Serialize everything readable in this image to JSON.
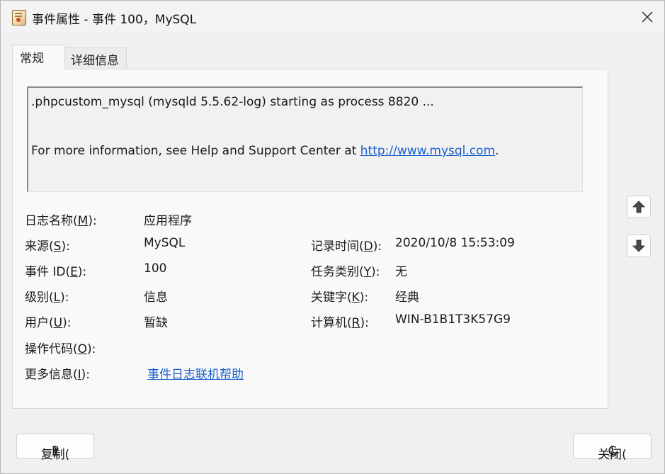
{
  "window": {
    "title": "事件属性 - 事件 100，MySQL",
    "close_icon": "close-icon"
  },
  "tabs": [
    {
      "label": "常规",
      "active": true
    },
    {
      "label": "详细信息",
      "active": false
    }
  ],
  "message": {
    "line1": ".phpcustom_mysql (mysqld 5.5.62-log) starting as process 8820 ...",
    "line2_prefix": "For more information, see Help and Support Center at ",
    "link": "http://www.mysql.com",
    "line2_suffix": "."
  },
  "fields": {
    "log_name": {
      "label_pre": "日志名称(",
      "key": "M",
      "label_post": "):",
      "value": "应用程序"
    },
    "source": {
      "label_pre": "来源(",
      "key": "S",
      "label_post": "):",
      "value": "MySQL"
    },
    "logged": {
      "label_pre": "记录时间(",
      "key": "D",
      "label_post": "):",
      "value": "2020/10/8 15:53:09"
    },
    "event_id": {
      "label_pre": "事件 ID(",
      "key": "E",
      "label_post": "):",
      "value": "100"
    },
    "task_category": {
      "label_pre": "任务类别(",
      "key": "Y",
      "label_post": "):",
      "value": "无"
    },
    "level": {
      "label_pre": "级别(",
      "key": "L",
      "label_post": "):",
      "value": "信息"
    },
    "keywords": {
      "label_pre": "关键字(",
      "key": "K",
      "label_post": "):",
      "value": "经典"
    },
    "user": {
      "label_pre": "用户(",
      "key": "U",
      "label_post": "):",
      "value": "暂缺"
    },
    "computer": {
      "label_pre": "计算机(",
      "key": "R",
      "label_post": "):",
      "value": "WIN-B1B1T3K57G9"
    },
    "opcode": {
      "label_pre": "操作代码(",
      "key": "O",
      "label_post": "):",
      "value": ""
    },
    "more_info": {
      "label_pre": "更多信息(",
      "key": "I",
      "label_post": "):",
      "link": "事件日志联机帮助"
    }
  },
  "nav": {
    "up_icon": "arrow-up-icon",
    "down_icon": "arrow-down-icon"
  },
  "buttons": {
    "copy": {
      "pre": "复制(",
      "key": "P",
      "post": ")"
    },
    "close": {
      "pre": "关闭(",
      "key": "C",
      "post": ")"
    }
  }
}
